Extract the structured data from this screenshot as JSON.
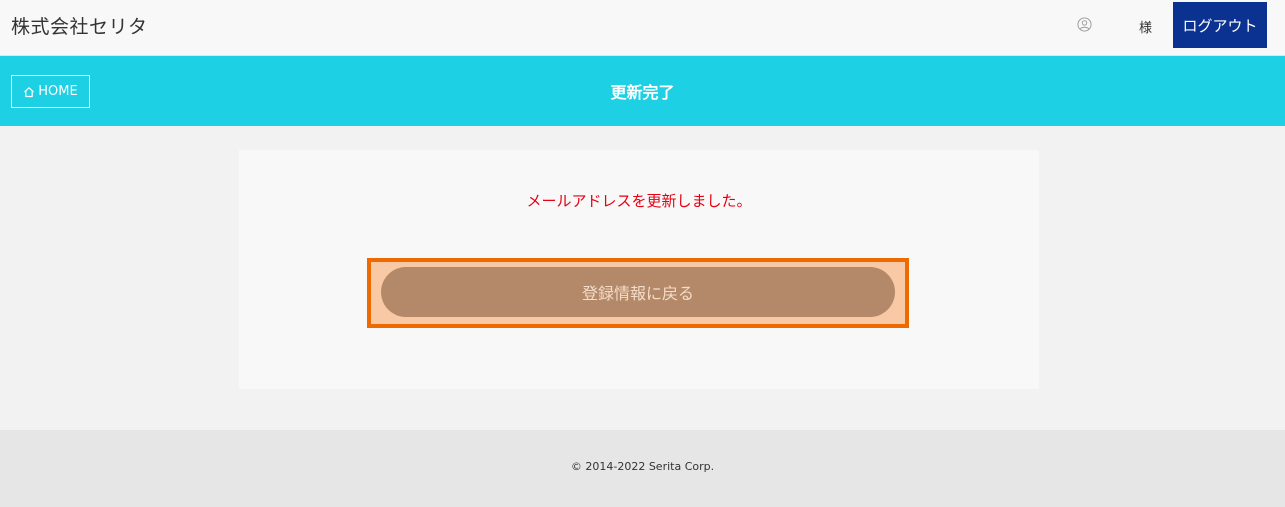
{
  "header": {
    "company_name": "株式会社セリタ",
    "user_icon": "user-circle-icon",
    "honorific": "様",
    "logout_label": "ログアウト"
  },
  "titlebar": {
    "home_label": "HOME",
    "home_icon": "home-icon",
    "page_title": "更新完了"
  },
  "main": {
    "message": "メールアドレスを更新しました。",
    "return_button_label": "登録情報に戻る"
  },
  "footer": {
    "copyright": "© 2014-2022 Serita Corp."
  },
  "colors": {
    "header_bg": "#f8f8f8",
    "titlebar_bg": "#1dd0e3",
    "logout_bg": "#0b3291",
    "message_color": "#e60012",
    "button_bg": "#b3896a",
    "highlight_border": "#ec6a00",
    "footer_bg": "#e6e6e6"
  }
}
